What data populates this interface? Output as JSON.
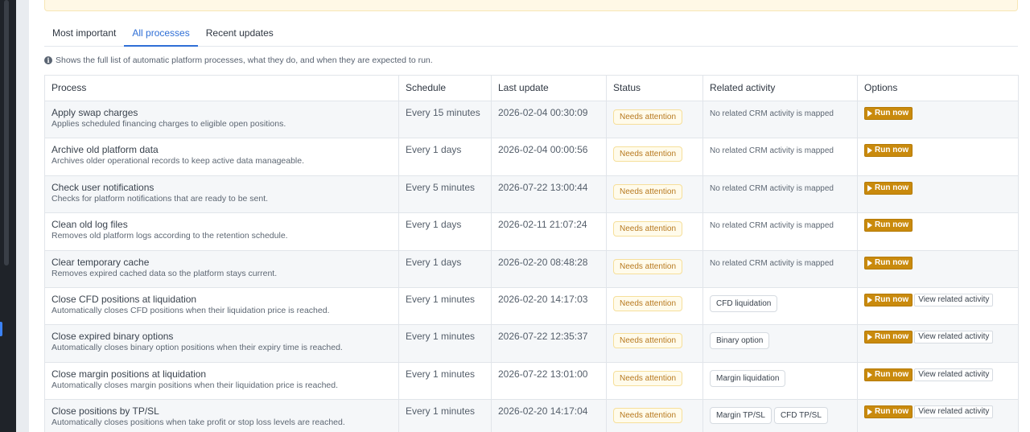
{
  "tabs": [
    {
      "label": "Most important",
      "active": false
    },
    {
      "label": "All processes",
      "active": true
    },
    {
      "label": "Recent updates",
      "active": false
    }
  ],
  "info": {
    "icon": "info-icon",
    "text": "Shows the full list of automatic platform processes, what they do, and when they are expected to run."
  },
  "table": {
    "headers": {
      "process": "Process",
      "schedule": "Schedule",
      "last_update": "Last update",
      "status": "Status",
      "related_activity": "Related activity",
      "options": "Options"
    },
    "rows": [
      {
        "name": "Apply swap charges",
        "description": "Applies scheduled financing charges to eligible open positions.",
        "schedule": "Every 15 minutes",
        "last_update": "2026-02-04 00:30:09",
        "status": "Needs attention",
        "no_activity": "No related CRM activity is mapped",
        "tags": [],
        "run_label": "Run now",
        "view_label": ""
      },
      {
        "name": "Archive old platform data",
        "description": "Archives older operational records to keep active data manageable.",
        "schedule": "Every 1 days",
        "last_update": "2026-02-04 00:00:56",
        "status": "Needs attention",
        "no_activity": "No related CRM activity is mapped",
        "tags": [],
        "run_label": "Run now",
        "view_label": ""
      },
      {
        "name": "Check user notifications",
        "description": "Checks for platform notifications that are ready to be sent.",
        "schedule": "Every 5 minutes",
        "last_update": "2026-07-22 13:00:44",
        "status": "Needs attention",
        "no_activity": "No related CRM activity is mapped",
        "tags": [],
        "run_label": "Run now",
        "view_label": ""
      },
      {
        "name": "Clean old log files",
        "description": "Removes old platform logs according to the retention schedule.",
        "schedule": "Every 1 days",
        "last_update": "2026-02-11 21:07:24",
        "status": "Needs attention",
        "no_activity": "No related CRM activity is mapped",
        "tags": [],
        "run_label": "Run now",
        "view_label": ""
      },
      {
        "name": "Clear temporary cache",
        "description": "Removes expired cached data so the platform stays current.",
        "schedule": "Every 1 days",
        "last_update": "2026-02-20 08:48:28",
        "status": "Needs attention",
        "no_activity": "No related CRM activity is mapped",
        "tags": [],
        "run_label": "Run now",
        "view_label": ""
      },
      {
        "name": "Close CFD positions at liquidation",
        "description": "Automatically closes CFD positions when their liquidation price is reached.",
        "schedule": "Every 1 minutes",
        "last_update": "2026-02-20 14:17:03",
        "status": "Needs attention",
        "no_activity": "",
        "tags": [
          "CFD liquidation"
        ],
        "run_label": "Run now",
        "view_label": "View related activity"
      },
      {
        "name": "Close expired binary options",
        "description": "Automatically closes binary option positions when their expiry time is reached.",
        "schedule": "Every 1 minutes",
        "last_update": "2026-07-22 12:35:37",
        "status": "Needs attention",
        "no_activity": "",
        "tags": [
          "Binary option"
        ],
        "run_label": "Run now",
        "view_label": "View related activity"
      },
      {
        "name": "Close margin positions at liquidation",
        "description": "Automatically closes margin positions when their liquidation price is reached.",
        "schedule": "Every 1 minutes",
        "last_update": "2026-07-22 13:01:00",
        "status": "Needs attention",
        "no_activity": "",
        "tags": [
          "Margin liquidation"
        ],
        "run_label": "Run now",
        "view_label": "View related activity"
      },
      {
        "name": "Close positions by TP/SL",
        "description": "Automatically closes positions when take profit or stop loss levels are reached.",
        "schedule": "Every 1 minutes",
        "last_update": "2026-02-20 14:17:04",
        "status": "Needs attention",
        "no_activity": "",
        "tags": [
          "Margin TP/SL",
          "CFD TP/SL"
        ],
        "run_label": "Run now",
        "view_label": "View related activity"
      }
    ]
  },
  "colors": {
    "accent": "#2f6fd6",
    "warning_badge_text": "#b7791f",
    "warning_badge_bg": "#fffbeb",
    "run_button_bg": "#c98a0d",
    "warning_strip_bg": "#fff8e6"
  },
  "icons": {
    "run": "play-icon",
    "info": "info-icon"
  }
}
